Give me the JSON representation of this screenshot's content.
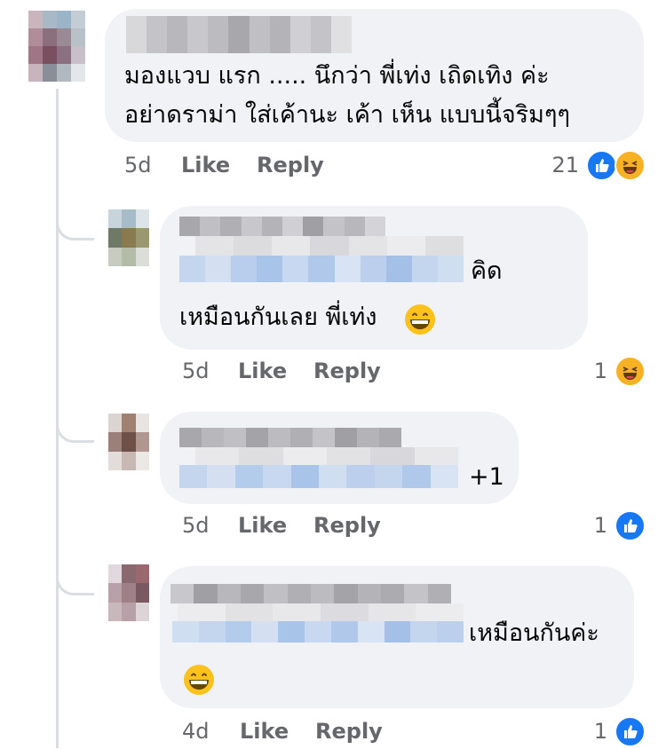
{
  "comments": [
    {
      "text_lines": [
        "มองแวบ แรก ..... นึกว่า พี่เท่ง เถิดเทิง ค่ะ",
        "อย่าดราม่า ใส่เค้านะ เค้า เห็น แบบนี้จริมๆๆ"
      ],
      "time": "5d",
      "like_label": "Like",
      "reply_label": "Reply",
      "reaction_count": "21",
      "reactions": [
        "like-icon",
        "haha-icon"
      ]
    },
    {
      "text_suffix": "คิด",
      "text_line2": "เหมือนกันเลย พี่เท่ง",
      "emoji": "grinning-face-icon",
      "time": "5d",
      "like_label": "Like",
      "reply_label": "Reply",
      "reaction_count": "1",
      "reactions": [
        "haha-icon"
      ]
    },
    {
      "text_suffix": "+1",
      "time": "5d",
      "like_label": "Like",
      "reply_label": "Reply",
      "reaction_count": "1",
      "reactions": [
        "like-icon"
      ]
    },
    {
      "text_suffix": "เหมือนกันค่ะ",
      "emoji": "grinning-face-icon",
      "time": "4d",
      "like_label": "Like",
      "reply_label": "Reply",
      "reaction_count": "1",
      "reactions": [
        "like-icon"
      ]
    }
  ],
  "colors": {
    "bubble": "#f0f2f5",
    "meta_text": "#65676b",
    "like_blue": "#1877f2",
    "haha_yellow": "#f7b125",
    "thread_line": "#dadde1"
  }
}
